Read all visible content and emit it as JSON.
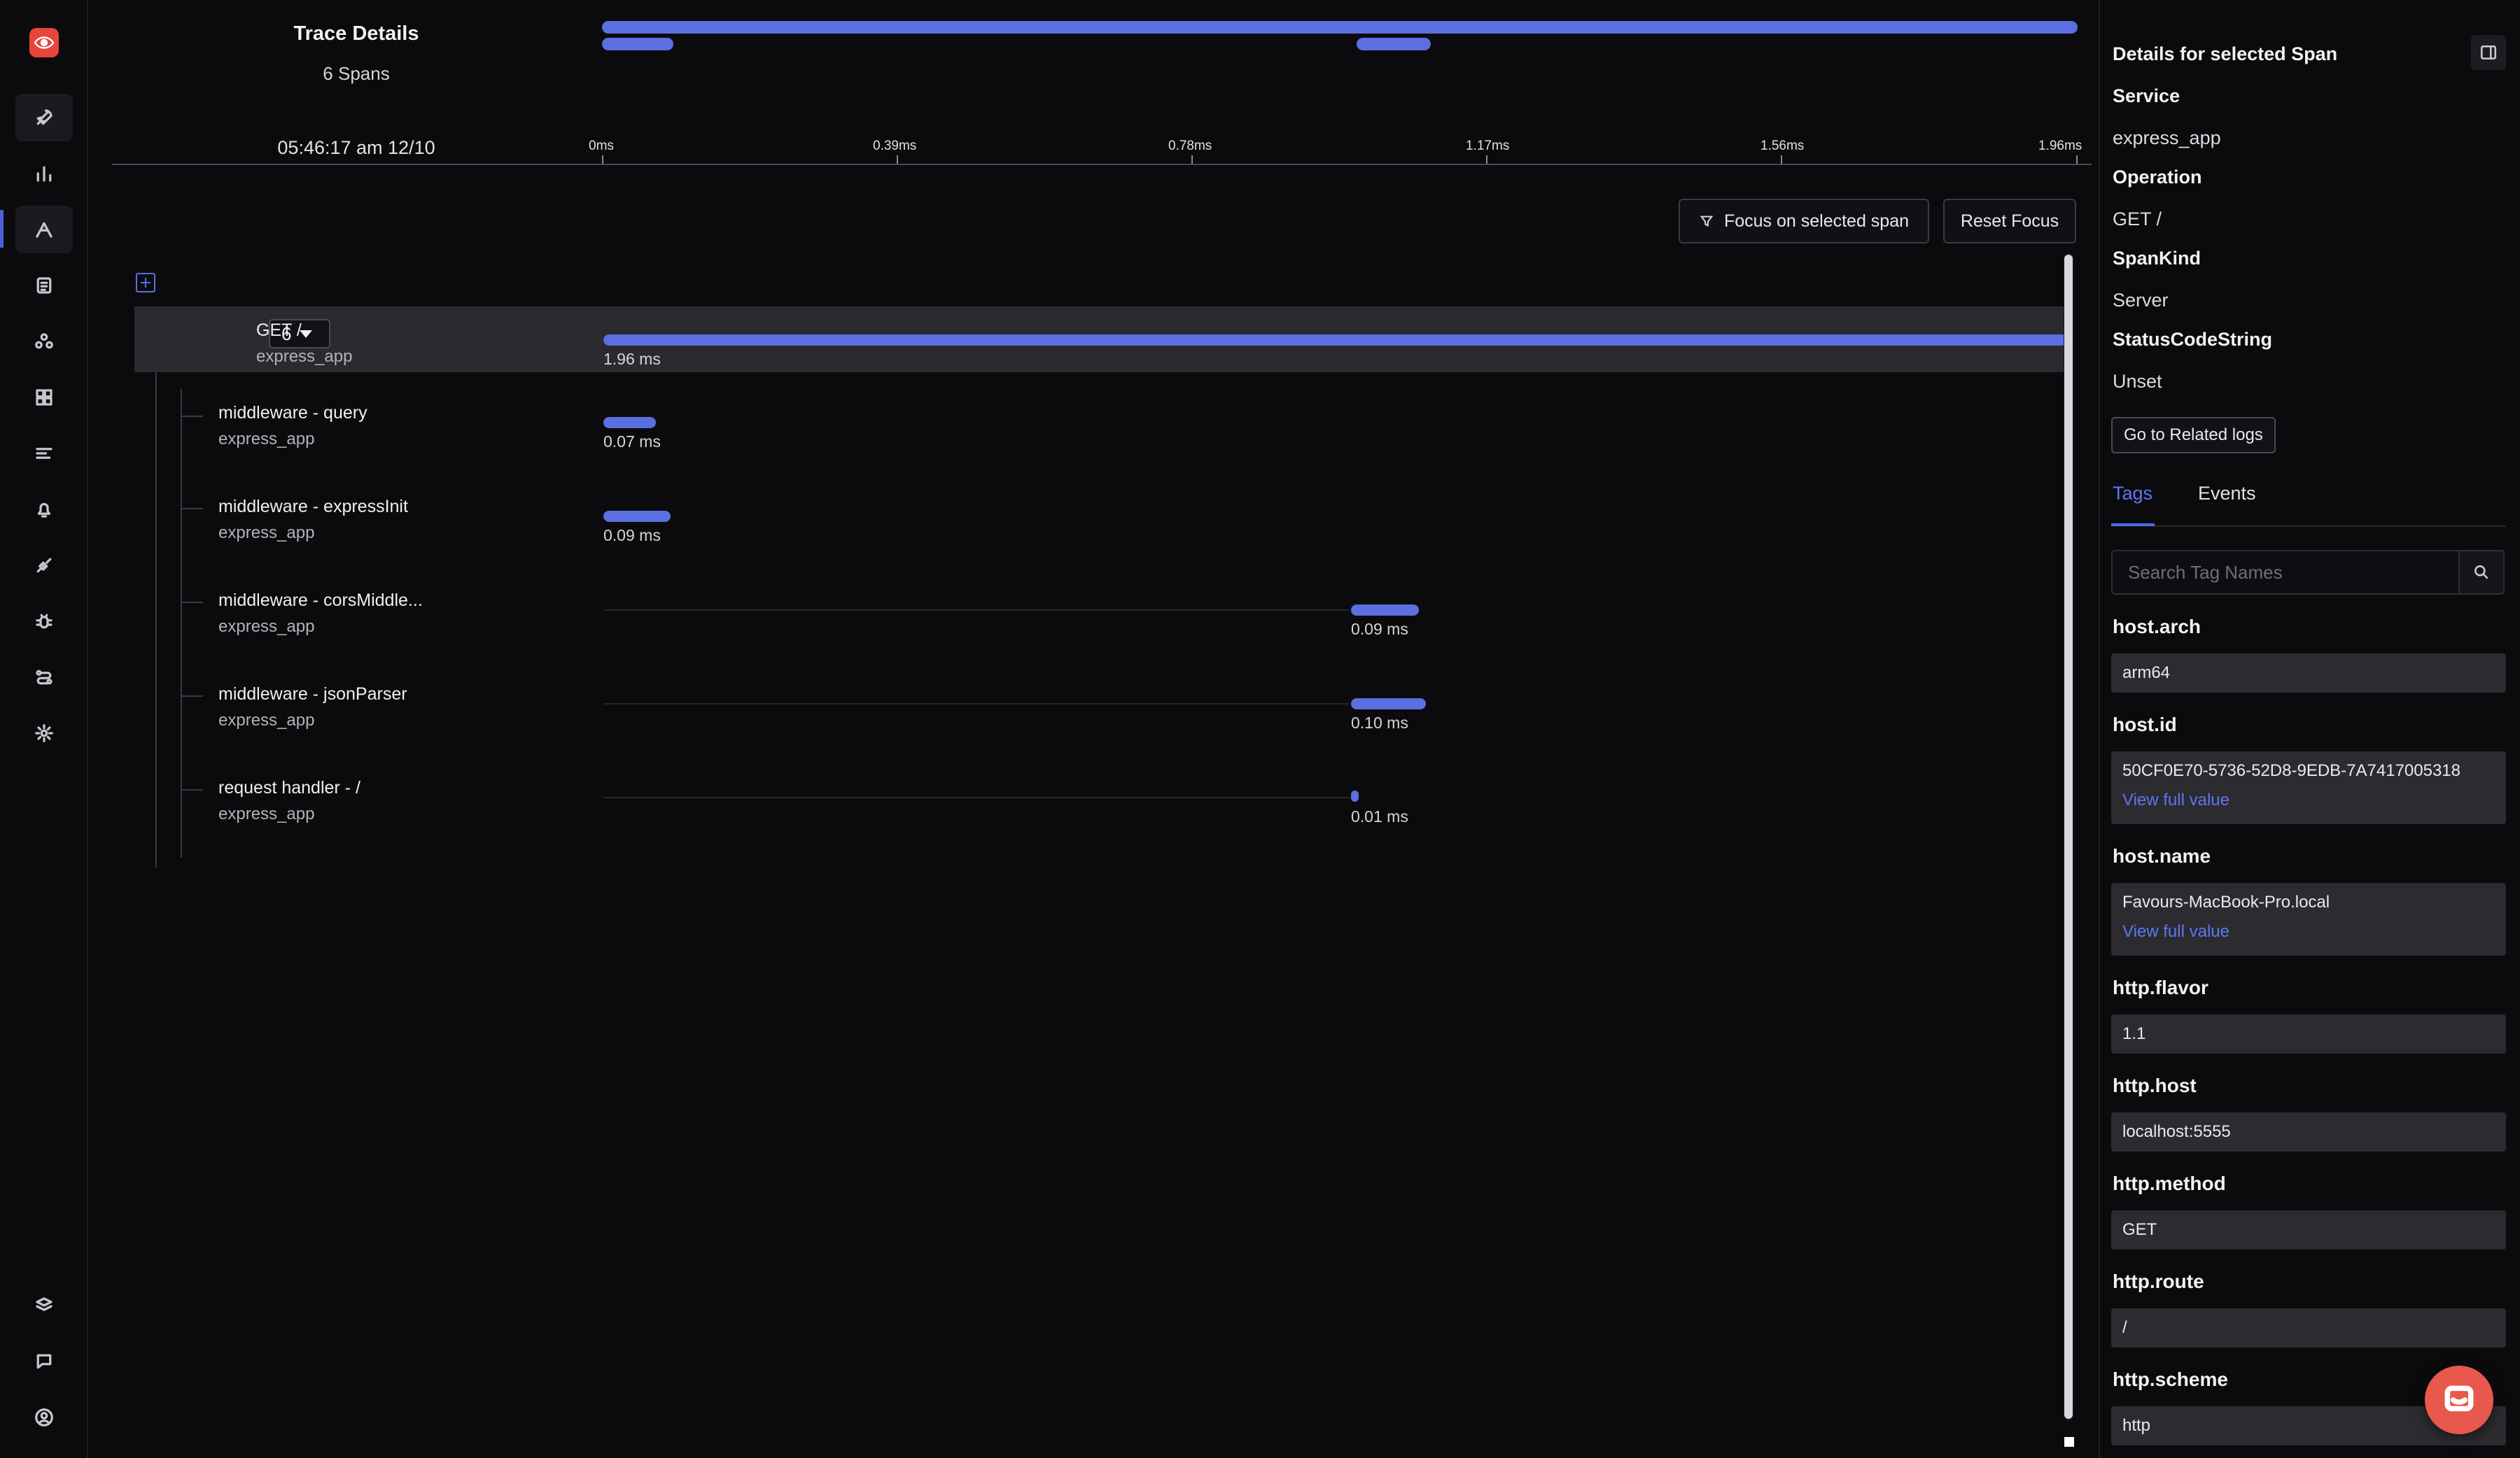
{
  "trace": {
    "title": "Trace Details",
    "span_count": "6 Spans",
    "start_time": "05:46:17 am 12/10"
  },
  "timeline": {
    "ticks": [
      "0ms",
      "0.39ms",
      "0.78ms",
      "1.17ms",
      "1.56ms",
      "1.96ms"
    ],
    "total_ms": 1.96
  },
  "actions": {
    "focus_label": "Focus on selected span",
    "reset_label": "Reset Focus"
  },
  "spans": [
    {
      "name": "GET /",
      "service": "express_app",
      "duration": "1.96 ms",
      "start_ms": 0,
      "duration_ms": 1.96,
      "child_count": "6"
    },
    {
      "name": "middleware - query",
      "service": "express_app",
      "duration": "0.07 ms",
      "start_ms": 0,
      "duration_ms": 0.07
    },
    {
      "name": "middleware - expressInit",
      "service": "express_app",
      "duration": "0.09 ms",
      "start_ms": 0,
      "duration_ms": 0.09
    },
    {
      "name": "middleware - corsMiddle...",
      "service": "express_app",
      "duration": "0.09 ms",
      "start_ms": 1.0,
      "duration_ms": 0.09
    },
    {
      "name": "middleware - jsonParser",
      "service": "express_app",
      "duration": "0.10 ms",
      "start_ms": 1.0,
      "duration_ms": 0.1
    },
    {
      "name": "request handler - /",
      "service": "express_app",
      "duration": "0.01 ms",
      "start_ms": 1.0,
      "duration_ms": 0.01
    }
  ],
  "details": {
    "title": "Details for selected Span",
    "service_label": "Service",
    "service_value": "express_app",
    "operation_label": "Operation",
    "operation_value": "GET /",
    "spankind_label": "SpanKind",
    "spankind_value": "Server",
    "status_label": "StatusCodeString",
    "status_value": "Unset",
    "related_logs_label": "Go to Related logs",
    "tabs": [
      "Tags",
      "Events"
    ],
    "search_placeholder": "Search Tag Names",
    "view_full_label": "View full value",
    "tags": [
      {
        "key": "host.arch",
        "value": "arm64"
      },
      {
        "key": "host.id",
        "value": "50CF0E70-5736-52D8-9EDB-7A7417005318"
      },
      {
        "key": "host.name",
        "value": "Favours-MacBook-Pro.local"
      },
      {
        "key": "http.flavor",
        "value": "1.1"
      },
      {
        "key": "http.host",
        "value": "localhost:5555"
      },
      {
        "key": "http.method",
        "value": "GET"
      },
      {
        "key": "http.route",
        "value": "/"
      },
      {
        "key": "http.scheme",
        "value": "http"
      }
    ]
  },
  "colors": {
    "accent": "#5b6fe0",
    "background": "#0b0b0e",
    "selected_row": "#2a2a2f",
    "brand": "#e8453c"
  },
  "nav_icons": [
    "rocket-icon",
    "bar-chart-icon",
    "traces-icon",
    "logs-icon",
    "service-map-icon",
    "dashboard-icon",
    "list-icon",
    "alerts-icon",
    "integrations-icon",
    "bug-icon",
    "pipelines-icon",
    "settings-icon",
    "layers-icon",
    "chat-icon",
    "user-icon"
  ]
}
